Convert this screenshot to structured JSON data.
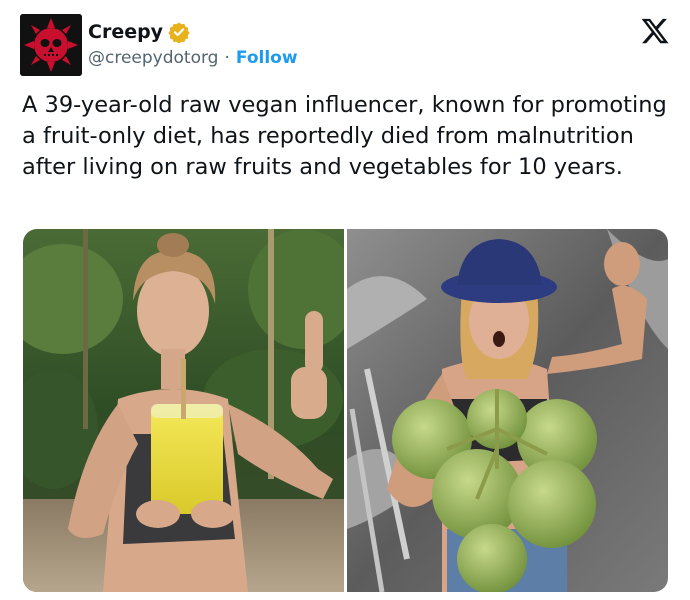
{
  "post": {
    "author": {
      "display_name": "Creepy",
      "handle": "@creepydotorg",
      "separator": "·",
      "follow_label": "Follow",
      "verified": true,
      "verified_badge_color": "#e8b21d"
    },
    "platform_icon": "x-logo-icon",
    "text": "A 39-year-old raw vegan influencer, known for promoting a fruit-only diet, has reportedly died from malnutrition after living on raw fruits and vegetables for 10 years.",
    "media": [
      {
        "icon": "photo-juice-thumbs-up"
      },
      {
        "icon": "photo-coconuts-flex"
      }
    ]
  },
  "colors": {
    "text": "#0f1419",
    "secondary": "#536471",
    "link": "#1d9bf0",
    "avatar_bg": "#111111",
    "avatar_mark": "#c8102e"
  }
}
